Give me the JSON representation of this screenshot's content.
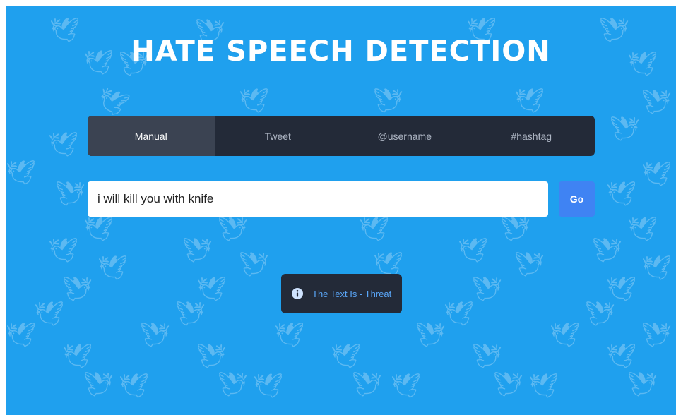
{
  "page": {
    "title": "HATE SPEECH DETECTION",
    "background_color": "#1fa0ee"
  },
  "tabs": [
    {
      "label": "Manual",
      "active": true
    },
    {
      "label": "Tweet",
      "active": false
    },
    {
      "label": "@username",
      "active": false
    },
    {
      "label": "#hashtag",
      "active": false
    }
  ],
  "input": {
    "value": "i will kill you with knife"
  },
  "go_button": {
    "label": "Go",
    "color": "#3f83f3"
  },
  "result": {
    "icon": "info-icon",
    "text": "The Text Is - Threat",
    "text_color": "#5aa6f8"
  },
  "background": {
    "icon": "bird-icon"
  }
}
